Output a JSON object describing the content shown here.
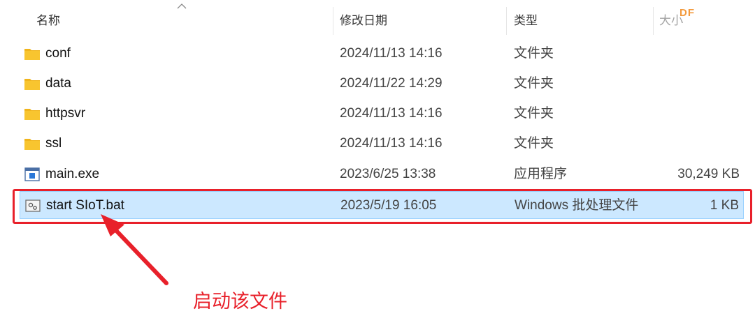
{
  "columns": {
    "name": "名称",
    "date_modified": "修改日期",
    "type": "类型",
    "size": "大小"
  },
  "watermark": "DF",
  "files": [
    {
      "name": "conf",
      "date": "2024/11/13 14:16",
      "type": "文件夹",
      "size": "",
      "icon": "folder-icon"
    },
    {
      "name": "data",
      "date": "2024/11/22 14:29",
      "type": "文件夹",
      "size": "",
      "icon": "folder-icon"
    },
    {
      "name": "httpsvr",
      "date": "2024/11/13 14:16",
      "type": "文件夹",
      "size": "",
      "icon": "folder-icon"
    },
    {
      "name": "ssl",
      "date": "2024/11/13 14:16",
      "type": "文件夹",
      "size": "",
      "icon": "folder-icon"
    },
    {
      "name": "main.exe",
      "date": "2023/6/25 13:38",
      "type": "应用程序",
      "size": "30,249 KB",
      "icon": "application-icon"
    },
    {
      "name": "start SIoT.bat",
      "date": "2023/5/19 16:05",
      "type": "Windows 批处理文件",
      "size": "1 KB",
      "icon": "batch-file-icon",
      "selected": true
    }
  ],
  "annotation": "启动该文件",
  "colors": {
    "selection_bg": "#cce8ff",
    "annotation_red": "#e8202a",
    "folder_yellow": "#f8c52f"
  }
}
